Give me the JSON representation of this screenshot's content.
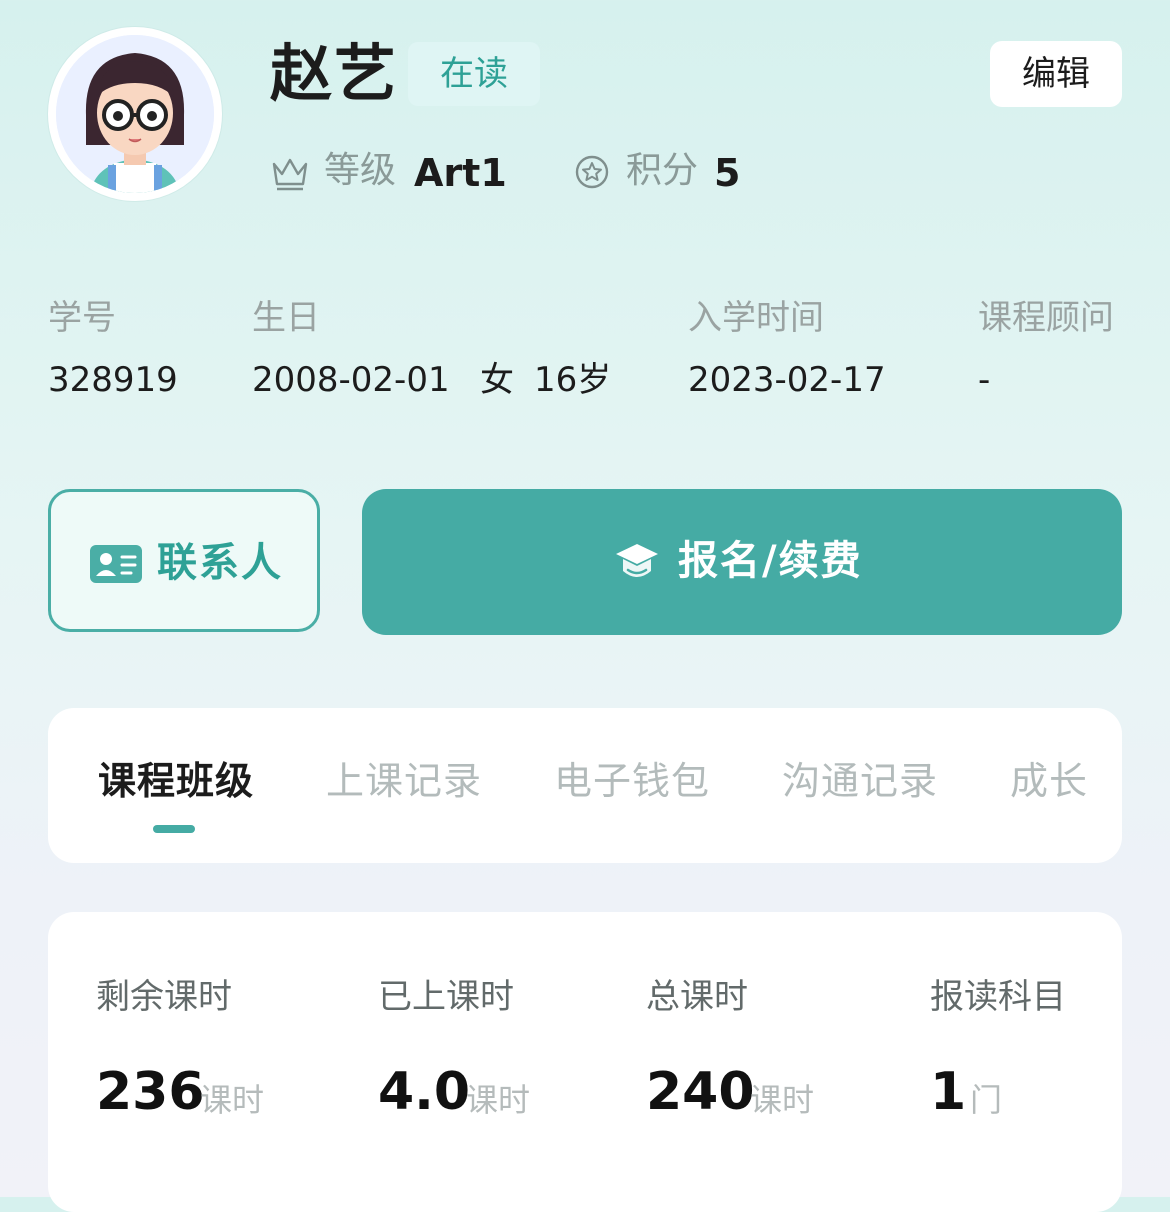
{
  "profile": {
    "name": "赵艺",
    "status": "在读",
    "edit_label": "编辑",
    "level_label": "等级",
    "level_value": "Art1",
    "points_label": "积分",
    "points_value": "5"
  },
  "info": {
    "student_id_label": "学号",
    "student_id": "328919",
    "birthday_label": "生日",
    "birthday": "2008-02-01",
    "gender": "女",
    "age": "16岁",
    "enroll_label": "入学时间",
    "enroll_date": "2023-02-17",
    "advisor_label": "课程顾问",
    "advisor": "-"
  },
  "actions": {
    "contact_label": "联系人",
    "enroll_label": "报名/续费"
  },
  "tabs": [
    {
      "label": "课程班级",
      "active": true
    },
    {
      "label": "上课记录",
      "active": false
    },
    {
      "label": "电子钱包",
      "active": false
    },
    {
      "label": "沟通记录",
      "active": false
    },
    {
      "label": "成长",
      "active": false
    }
  ],
  "stats": [
    {
      "label": "剩余课时",
      "value": "236",
      "unit": "课时"
    },
    {
      "label": "已上课时",
      "value": "4.0",
      "unit": "课时"
    },
    {
      "label": "总课时",
      "value": "240",
      "unit": "课时"
    },
    {
      "label": "报读科目",
      "value": "1",
      "unit": "门"
    }
  ],
  "colors": {
    "accent": "#45aba4",
    "accent_text": "#2ea196",
    "muted": "#9aa3a2"
  },
  "icons": {
    "level": "crown-icon",
    "points": "star-badge-icon",
    "contact": "contact-card-icon",
    "enroll": "graduation-cap-icon"
  }
}
